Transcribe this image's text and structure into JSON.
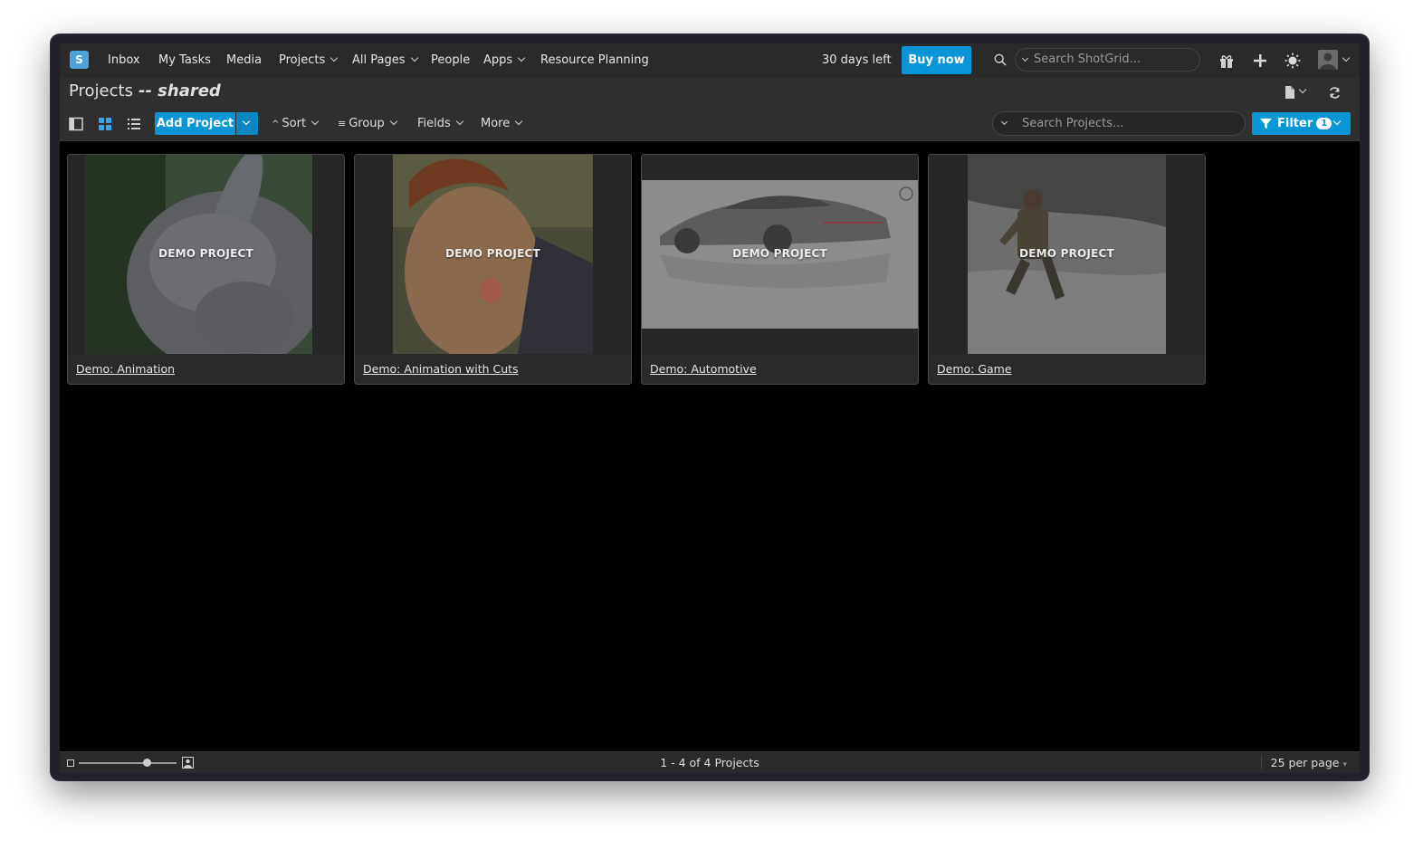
{
  "nav": {
    "items": [
      "Inbox",
      "My Tasks",
      "Media",
      "Projects",
      "All Pages",
      "People",
      "Apps",
      "Resource Planning"
    ],
    "trial_text": "30 days left",
    "buy_label": "Buy now",
    "search_placeholder": "Search ShotGrid...",
    "logo_letter": "S"
  },
  "page": {
    "title": "Projects",
    "subtitle": "-- shared"
  },
  "toolbar": {
    "add_label": "Add Project",
    "sort_label": "Sort",
    "group_label": "Group",
    "fields_label": "Fields",
    "more_label": "More",
    "search_placeholder": "Search Projects...",
    "filter_label": "Filter",
    "filter_count": "1"
  },
  "projects": [
    {
      "overlay": "DEMO PROJECT",
      "name": "Demo: Animation"
    },
    {
      "overlay": "DEMO PROJECT",
      "name": "Demo: Animation with Cuts"
    },
    {
      "overlay": "DEMO PROJECT",
      "name": "Demo: Automotive"
    },
    {
      "overlay": "DEMO PROJECT",
      "name": "Demo: Game"
    }
  ],
  "footer": {
    "pager_text": "1 - 4 of 4 Projects",
    "per_page": "25 per page",
    "thumb_size_level": 0.7
  },
  "colors": {
    "accent": "#0a96d6",
    "nav_bg": "#2a2a2a",
    "content_bg": "#000000"
  }
}
